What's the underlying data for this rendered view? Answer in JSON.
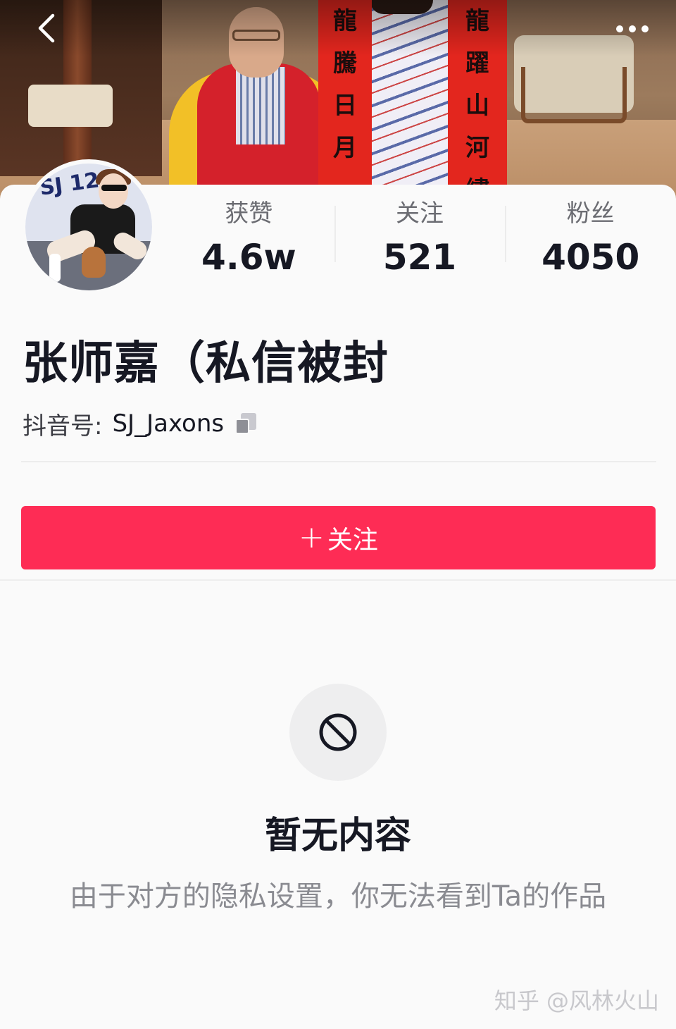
{
  "cover": {
    "couplet_left": [
      "龍",
      "騰",
      "日",
      "月"
    ],
    "couplet_right": [
      "龍",
      "躍",
      "山",
      "河",
      "繡"
    ]
  },
  "nav": {
    "back_icon": "chevron-left-icon",
    "more_icon": "more-horizontal-icon"
  },
  "profile": {
    "avatar_tag": "SJ 12",
    "stats": [
      {
        "label": "获赞",
        "value": "4.6w"
      },
      {
        "label": "关注",
        "value": "521"
      },
      {
        "label": "粉丝",
        "value": "4050"
      }
    ],
    "nickname": "张师嘉（私信被封",
    "douyin_id_label": "抖音号:",
    "douyin_id_value": "SJ_Jaxons",
    "copy_icon": "copy-icon"
  },
  "follow_button": {
    "plus": "+",
    "label": "关注",
    "color": "#fe2c55"
  },
  "empty_state": {
    "icon": "forbidden-icon",
    "title": "暂无内容",
    "description": "由于对方的隐私设置，你无法看到Ta的作品"
  },
  "watermark": "知乎 @风林火山"
}
